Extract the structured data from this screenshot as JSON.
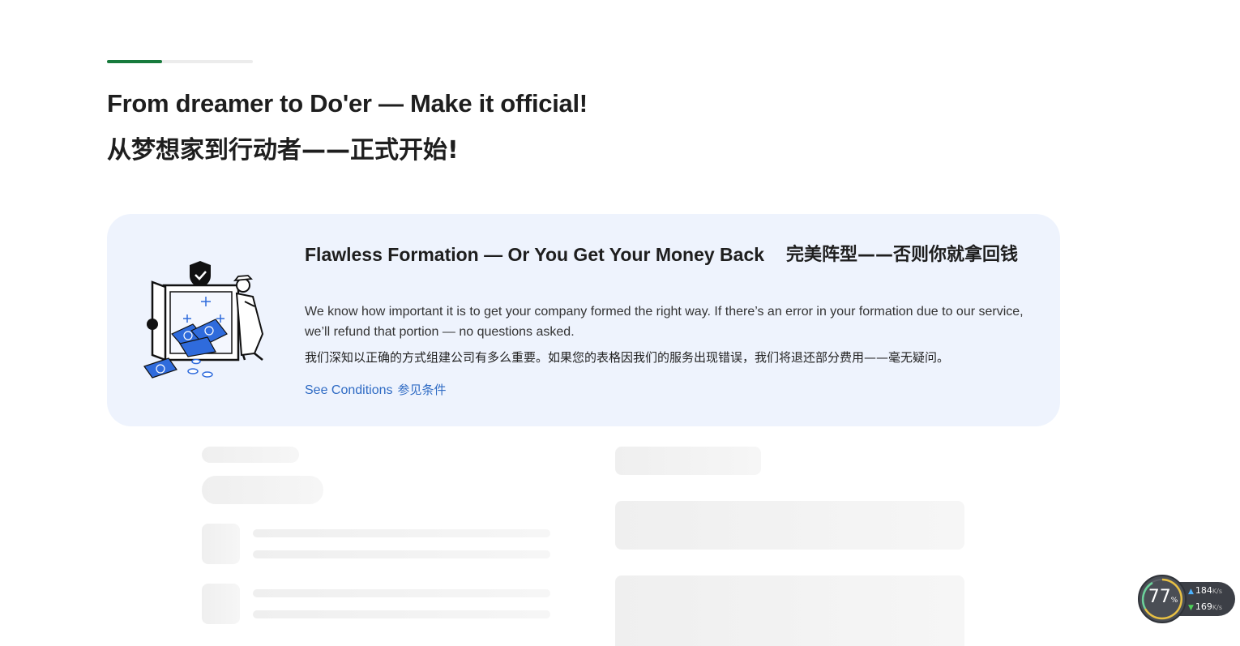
{
  "progress": {
    "fraction": 0.38,
    "fill_color": "#177a3c"
  },
  "header": {
    "title_en": "From dreamer to Do'er — Make it official!",
    "title_zh": "从梦想家到行动者——正式开始!"
  },
  "guarantee_card": {
    "heading_en": "Flawless Formation — Or You Get Your Money Back",
    "heading_zh": "完美阵型——否则你就拿回钱",
    "description_en": "We know how important it is to get your company formed the right way. If there’s an error in your formation due to our service, we’ll refund that portion — no questions asked.",
    "description_zh": "我们深知以正确的方式组建公司有多么重要。如果您的表格因我们的服务出现错误，我们将退还部分费用——毫无疑问。",
    "link_en": "See Conditions",
    "link_zh": "参见条件",
    "icon": "safe-with-money-illustration",
    "background_color": "#eef3fd",
    "link_color": "#2f6bc4"
  },
  "speed_widget": {
    "percent": "77",
    "percent_unit": "%",
    "upload": "184",
    "download": "169",
    "rate_unit": "K/s"
  }
}
